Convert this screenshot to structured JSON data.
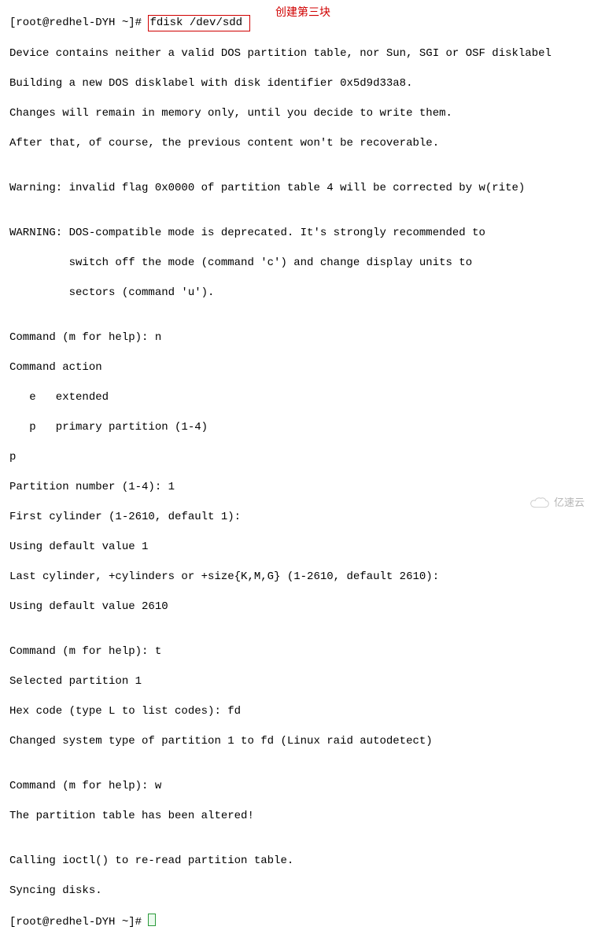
{
  "prompt1": "[root@redhel-DYH ~]# ",
  "command": "fdisk /dev/sdd ",
  "annotation": "创建第三块",
  "lines": {
    "l02": "Device contains neither a valid DOS partition table, nor Sun, SGI or OSF disklabel",
    "l03": "Building a new DOS disklabel with disk identifier 0x5d9d33a8.",
    "l04": "Changes will remain in memory only, until you decide to write them.",
    "l05": "After that, of course, the previous content won't be recoverable.",
    "l06": "",
    "l07": "Warning: invalid flag 0x0000 of partition table 4 will be corrected by w(rite)",
    "l08": "",
    "l09": "WARNING: DOS-compatible mode is deprecated. It's strongly recommended to",
    "l10": "         switch off the mode (command 'c') and change display units to",
    "l11": "         sectors (command 'u').",
    "l12": "",
    "l13": "Command (m for help): n",
    "l14": "Command action",
    "l15": "   e   extended",
    "l16": "   p   primary partition (1-4)",
    "l17": "p",
    "l18": "Partition number (1-4): 1",
    "l19": "First cylinder (1-2610, default 1):",
    "l20": "Using default value 1",
    "l21": "Last cylinder, +cylinders or +size{K,M,G} (1-2610, default 2610):",
    "l22": "Using default value 2610",
    "l23": "",
    "l24": "Command (m for help): t",
    "l25": "Selected partition 1",
    "l26": "Hex code (type L to list codes): fd",
    "l27": "Changed system type of partition 1 to fd (Linux raid autodetect)",
    "l28": "",
    "l29": "Command (m for help): w",
    "l30": "The partition table has been altered!",
    "l31": "",
    "l32": "Calling ioctl() to re-read partition table.",
    "l33": "Syncing disks."
  },
  "prompt2": "[root@redhel-DYH ~]# ",
  "watermark": "亿速云"
}
